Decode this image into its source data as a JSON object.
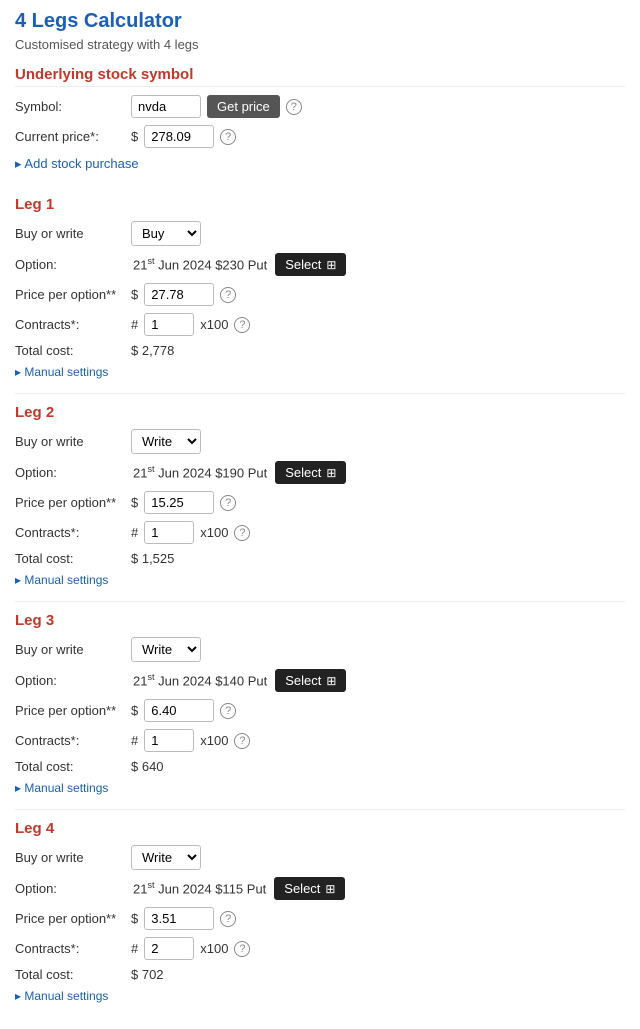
{
  "page": {
    "title": "4 Legs Calculator",
    "subtitle": "Customised strategy with 4 legs"
  },
  "underlying": {
    "section_title": "Underlying stock symbol",
    "symbol_label": "Symbol:",
    "symbol_value": "nvda",
    "get_price_label": "Get price",
    "current_price_label": "Current price*:",
    "currency": "$",
    "current_price_value": "278.09",
    "add_stock_label": "Add stock purchase"
  },
  "legs": [
    {
      "title": "Leg 1",
      "buy_or_write_label": "Buy or write",
      "buy_or_write_value": "Buy",
      "option_label": "Option:",
      "option_date": "21",
      "option_date_sup": "st",
      "option_text": " Jun 2024 $230 Put",
      "select_label": "Select",
      "price_per_option_label": "Price per option*",
      "currency": "$",
      "price_value": "27.78",
      "contracts_label": "Contracts*:",
      "contracts_hash": "#",
      "contracts_value": "1",
      "x100": "x100",
      "total_cost_label": "Total cost:",
      "total_cost_value": "$ 2,778",
      "manual_settings_label": "Manual settings"
    },
    {
      "title": "Leg 2",
      "buy_or_write_label": "Buy or write",
      "buy_or_write_value": "Write",
      "option_label": "Option:",
      "option_date": "21",
      "option_date_sup": "st",
      "option_text": " Jun 2024 $190 Put",
      "select_label": "Select",
      "price_per_option_label": "Price per option*",
      "currency": "$",
      "price_value": "15.25",
      "contracts_label": "Contracts*:",
      "contracts_hash": "#",
      "contracts_value": "1",
      "x100": "x100",
      "total_cost_label": "Total cost:",
      "total_cost_value": "$ 1,525",
      "manual_settings_label": "Manual settings"
    },
    {
      "title": "Leg 3",
      "buy_or_write_label": "Buy or write",
      "buy_or_write_value": "Write",
      "option_label": "Option:",
      "option_date": "21",
      "option_date_sup": "st",
      "option_text": " Jun 2024 $140 Put",
      "select_label": "Select",
      "price_per_option_label": "Price per option*",
      "currency": "$",
      "price_value": "6.40",
      "contracts_label": "Contracts*:",
      "contracts_hash": "#",
      "contracts_value": "1",
      "x100": "x100",
      "total_cost_label": "Total cost:",
      "total_cost_value": "$ 640",
      "manual_settings_label": "Manual settings"
    },
    {
      "title": "Leg 4",
      "buy_or_write_label": "Buy or write",
      "buy_or_write_value": "Write",
      "option_label": "Option:",
      "option_date": "21",
      "option_date_sup": "st",
      "option_text": " Jun 2024 $115 Put",
      "select_label": "Select",
      "price_per_option_label": "Price per option*",
      "currency": "$",
      "price_value": "3.51",
      "contracts_label": "Contracts*:",
      "contracts_hash": "#",
      "contracts_value": "2",
      "x100": "x100",
      "total_cost_label": "Total cost:",
      "total_cost_value": "$ 702",
      "manual_settings_label": "Manual settings"
    }
  ]
}
